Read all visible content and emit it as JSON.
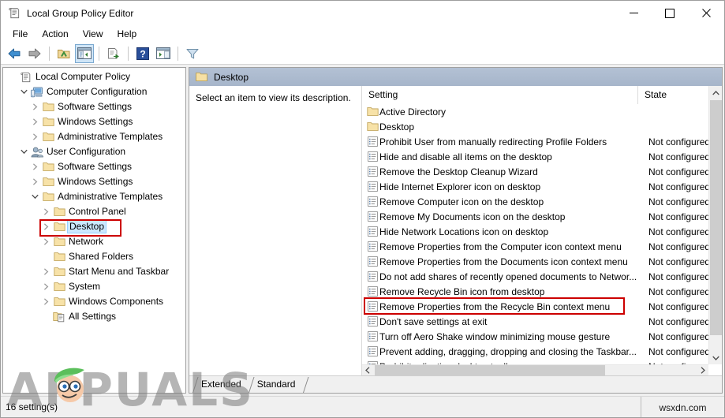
{
  "window": {
    "title": "Local Group Policy Editor",
    "icon": "policy-document-icon",
    "controls": {
      "minimize": "minimize-icon",
      "maximize": "maximize-icon",
      "close": "close-icon"
    }
  },
  "menu": {
    "items": [
      {
        "label": "File"
      },
      {
        "label": "Action"
      },
      {
        "label": "View"
      },
      {
        "label": "Help"
      }
    ]
  },
  "toolbar": {
    "buttons": [
      {
        "name": "back-icon",
        "title": "Back"
      },
      {
        "name": "forward-icon",
        "title": "Forward"
      },
      {
        "name": "up-one-level-icon",
        "title": "Up One Level"
      },
      {
        "name": "show-hide-console-tree-icon",
        "title": "Show/Hide Console Tree",
        "active": true
      },
      {
        "name": "export-list-icon",
        "title": "Export List"
      },
      {
        "name": "help-icon",
        "title": "Help"
      },
      {
        "name": "show-hide-action-pane-icon",
        "title": "Show/Hide Action Pane"
      },
      {
        "name": "filter-icon",
        "title": "Filter"
      }
    ]
  },
  "tree": {
    "nodes": [
      {
        "label": "Local Computer Policy",
        "depth": 0,
        "chevron": "none",
        "icon": "policy-document-icon",
        "selected": false
      },
      {
        "label": "Computer Configuration",
        "depth": 1,
        "chevron": "expanded",
        "icon": "computer-icon",
        "selected": false
      },
      {
        "label": "Software Settings",
        "depth": 2,
        "chevron": "collapsed",
        "icon": "folder-icon",
        "selected": false
      },
      {
        "label": "Windows Settings",
        "depth": 2,
        "chevron": "collapsed",
        "icon": "folder-icon",
        "selected": false
      },
      {
        "label": "Administrative Templates",
        "depth": 2,
        "chevron": "collapsed",
        "icon": "folder-icon",
        "selected": false
      },
      {
        "label": "User Configuration",
        "depth": 1,
        "chevron": "expanded",
        "icon": "user-icon",
        "selected": false
      },
      {
        "label": "Software Settings",
        "depth": 2,
        "chevron": "collapsed",
        "icon": "folder-icon",
        "selected": false
      },
      {
        "label": "Windows Settings",
        "depth": 2,
        "chevron": "collapsed",
        "icon": "folder-icon",
        "selected": false
      },
      {
        "label": "Administrative Templates",
        "depth": 2,
        "chevron": "expanded",
        "icon": "folder-icon",
        "selected": false
      },
      {
        "label": "Control Panel",
        "depth": 3,
        "chevron": "collapsed",
        "icon": "folder-icon",
        "selected": false
      },
      {
        "label": "Desktop",
        "depth": 3,
        "chevron": "collapsed",
        "icon": "folder-icon",
        "selected": true
      },
      {
        "label": "Network",
        "depth": 3,
        "chevron": "collapsed",
        "icon": "folder-icon",
        "selected": false
      },
      {
        "label": "Shared Folders",
        "depth": 3,
        "chevron": "none",
        "icon": "folder-icon",
        "selected": false
      },
      {
        "label": "Start Menu and Taskbar",
        "depth": 3,
        "chevron": "collapsed",
        "icon": "folder-icon",
        "selected": false
      },
      {
        "label": "System",
        "depth": 3,
        "chevron": "collapsed",
        "icon": "folder-icon",
        "selected": false
      },
      {
        "label": "Windows Components",
        "depth": 3,
        "chevron": "collapsed",
        "icon": "folder-icon",
        "selected": false
      },
      {
        "label": "All Settings",
        "depth": 3,
        "chevron": "none",
        "icon": "all-settings-icon",
        "selected": false
      }
    ]
  },
  "content_header": {
    "icon": "folder-icon",
    "title": "Desktop"
  },
  "description_pane": {
    "text": "Select an item to view its description."
  },
  "list": {
    "columns": [
      {
        "label": "Setting"
      },
      {
        "label": "State"
      }
    ],
    "rows": [
      {
        "icon": "folder-icon",
        "name": "Active Directory",
        "state": ""
      },
      {
        "icon": "folder-icon",
        "name": "Desktop",
        "state": ""
      },
      {
        "icon": "policy-setting-icon",
        "name": "Prohibit User from manually redirecting Profile Folders",
        "state": "Not configured"
      },
      {
        "icon": "policy-setting-icon",
        "name": "Hide and disable all items on the desktop",
        "state": "Not configured"
      },
      {
        "icon": "policy-setting-icon",
        "name": "Remove the Desktop Cleanup Wizard",
        "state": "Not configured"
      },
      {
        "icon": "policy-setting-icon",
        "name": "Hide Internet Explorer icon on desktop",
        "state": "Not configured"
      },
      {
        "icon": "policy-setting-icon",
        "name": "Remove Computer icon on the desktop",
        "state": "Not configured"
      },
      {
        "icon": "policy-setting-icon",
        "name": "Remove My Documents icon on the desktop",
        "state": "Not configured"
      },
      {
        "icon": "policy-setting-icon",
        "name": "Hide Network Locations icon on desktop",
        "state": "Not configured"
      },
      {
        "icon": "policy-setting-icon",
        "name": "Remove Properties from the Computer icon context menu",
        "state": "Not configured"
      },
      {
        "icon": "policy-setting-icon",
        "name": "Remove Properties from the Documents icon context menu",
        "state": "Not configured"
      },
      {
        "icon": "policy-setting-icon",
        "name": "Do not add shares of recently opened documents to Networ...",
        "state": "Not configured"
      },
      {
        "icon": "policy-setting-icon",
        "name": "Remove Recycle Bin icon from desktop",
        "state": "Not configured"
      },
      {
        "icon": "policy-setting-icon",
        "name": "Remove Properties from the Recycle Bin context menu",
        "state": "Not configured",
        "highlighted": true
      },
      {
        "icon": "policy-setting-icon",
        "name": "Don't save settings at exit",
        "state": "Not configured"
      },
      {
        "icon": "policy-setting-icon",
        "name": "Turn off Aero Shake window minimizing mouse gesture",
        "state": "Not configured"
      },
      {
        "icon": "policy-setting-icon",
        "name": "Prevent adding, dragging, dropping and closing the Taskbar...",
        "state": "Not configured"
      },
      {
        "icon": "policy-setting-icon",
        "name": "Prohibit adjusting desktop toolbars",
        "state": "Not configured"
      }
    ]
  },
  "tabs": [
    {
      "label": "Extended",
      "selected": false
    },
    {
      "label": "Standard",
      "selected": true
    }
  ],
  "statusbar": {
    "text": "16 setting(s)"
  },
  "watermarks": {
    "appuals": "PPUALS",
    "appuals_full": "APPUALS",
    "wsxdn": "wsxdn.com"
  },
  "colors": {
    "header_blue": "#a6b5ca",
    "selection_blue": "#cce8ff",
    "highlight_red": "#cc0000",
    "toolbar_active": "#cfe5f7"
  }
}
